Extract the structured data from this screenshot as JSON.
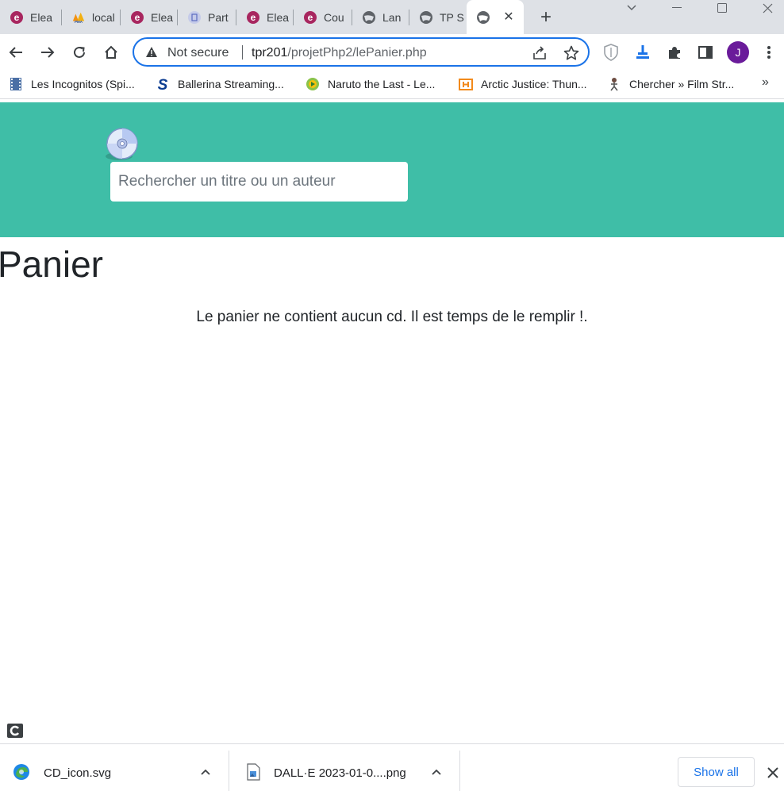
{
  "browser": {
    "tabs": [
      {
        "title": "Elea",
        "icon": "elea-icon"
      },
      {
        "title": "local",
        "icon": "phpmyadmin-icon"
      },
      {
        "title": "Elea",
        "icon": "elea-icon"
      },
      {
        "title": "Part",
        "icon": "document-icon"
      },
      {
        "title": "Elea",
        "icon": "elea-icon"
      },
      {
        "title": "Cou",
        "icon": "elea-icon"
      },
      {
        "title": "Lan",
        "icon": "globe-icon"
      },
      {
        "title": "TP S",
        "icon": "globe-icon"
      },
      {
        "title": "",
        "icon": "globe-icon",
        "active": true
      }
    ],
    "address": {
      "security_label": "Not secure",
      "host": "tpr201",
      "path": "/projetPhp2/lePanier.php"
    },
    "profile_initial": "J",
    "bookmarks": [
      {
        "label": "Les Incognitos (Spi...",
        "icon": "film-icon"
      },
      {
        "label": "Ballerina Streaming...",
        "icon": "s-logo-icon"
      },
      {
        "label": "Naruto the Last - Le...",
        "icon": "play-circle-icon"
      },
      {
        "label": "Arctic Justice: Thun...",
        "icon": "h-logo-icon"
      },
      {
        "label": "Chercher » Film Str...",
        "icon": "figure-icon"
      }
    ],
    "bookmarks_more": "»"
  },
  "page": {
    "search_placeholder": "Rechercher un titre ou un auteur",
    "title": "Panier",
    "empty_message": "Le panier ne contient aucun cd. Il est temps de le remplir !."
  },
  "downloads": {
    "items": [
      {
        "name": "CD_icon.svg",
        "icon": "edge-icon"
      },
      {
        "name": "DALL·E 2023-01-0....png",
        "icon": "image-file-icon"
      }
    ],
    "show_all": "Show all"
  },
  "colors": {
    "banner": "#3fbea7",
    "accent": "#1a73e8",
    "avatar": "#6a1b9a"
  }
}
